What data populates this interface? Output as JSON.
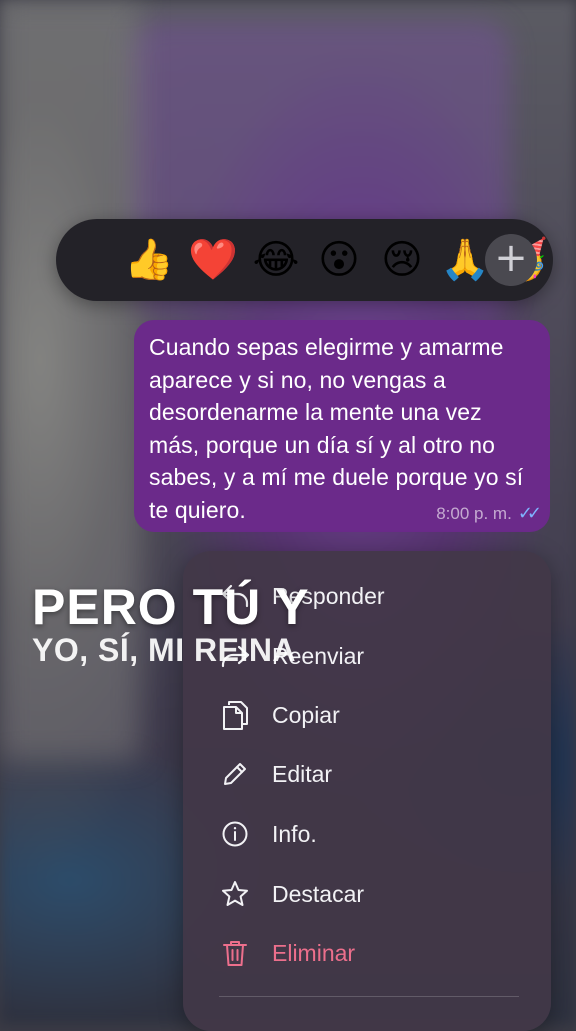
{
  "reactions": {
    "emojis": [
      {
        "glyph": "👍",
        "name": "thumbs-up"
      },
      {
        "glyph": "❤️",
        "name": "red-heart"
      },
      {
        "glyph": "😂",
        "name": "tears-of-joy"
      },
      {
        "glyph": "😮",
        "name": "surprised"
      },
      {
        "glyph": "😢",
        "name": "crying"
      },
      {
        "glyph": "🙏",
        "name": "folded-hands"
      },
      {
        "glyph": "🥳",
        "name": "partying-face"
      }
    ],
    "add_label": "+"
  },
  "message": {
    "text": "Cuando sepas elegirme y amarme aparece y si no, no vengas a desordenarme la mente una vez más, porque un día sí y al otro no sabes, y a mí me duele porque yo sí te quiero.",
    "time": "8:00 p. m.",
    "status": "read",
    "bubble_color": "#6b2a8a",
    "check_color": "#7fb3ff"
  },
  "overlay": {
    "line1": "PERO TÚ Y",
    "line2": "YO, SÍ, MI REINA"
  },
  "menu": {
    "items": [
      {
        "label": "Responder",
        "icon": "reply-icon"
      },
      {
        "label": "Reenviar",
        "icon": "forward-icon"
      },
      {
        "label": "Copiar",
        "icon": "copy-icon"
      },
      {
        "label": "Editar",
        "icon": "pencil-icon"
      },
      {
        "label": "Info.",
        "icon": "info-icon"
      },
      {
        "label": "Destacar",
        "icon": "star-icon"
      },
      {
        "label": "Eliminar",
        "icon": "trash-icon",
        "danger": true
      }
    ],
    "danger_color": "#ec6f8c"
  }
}
